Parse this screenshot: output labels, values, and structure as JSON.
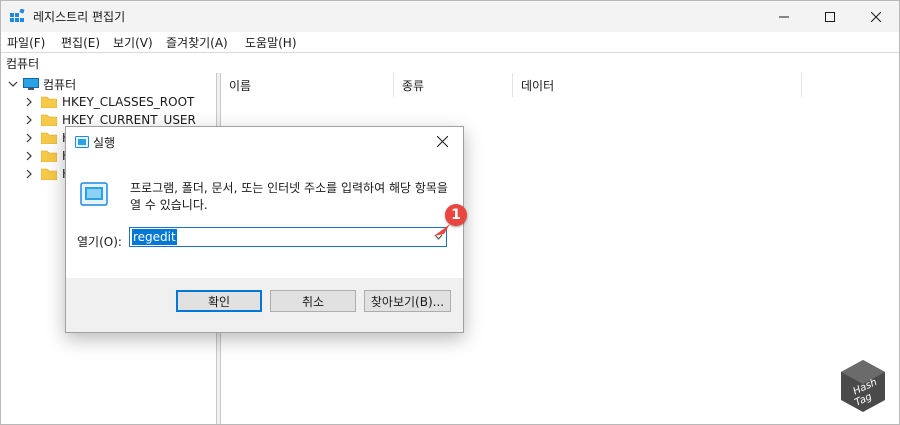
{
  "window": {
    "title": "레지스트리 편집기",
    "minimize_icon": "minimize-icon",
    "maximize_icon": "maximize-icon",
    "close_icon": "close-icon"
  },
  "menu": [
    "파일(F)",
    "편집(E)",
    "보기(V)",
    "즐겨찾기(A)",
    "도움말(H)"
  ],
  "address": "컴퓨터",
  "tree": {
    "root": "컴퓨터",
    "items": [
      "HKEY_CLASSES_ROOT",
      "HKEY_CURRENT_USER",
      "H",
      "H",
      "H"
    ]
  },
  "columns": [
    "이름",
    "종류",
    "데이터"
  ],
  "dialog": {
    "title": "실행",
    "description": "프로그램, 폴더, 문서, 또는 인터넷 주소를 입력하여 해당 항목을 열 수 있습니다.",
    "open_label": "열기(O):",
    "input_value": "regedit",
    "buttons": {
      "ok": "확인",
      "cancel": "취소",
      "browse": "찾아보기(B)..."
    }
  },
  "annotation": {
    "badge": "1"
  },
  "watermark": {
    "line1": "Hash",
    "line2": "Tag"
  },
  "colors": {
    "accent": "#0078d7",
    "badge": "#e8463e",
    "titlebar": "#f3f3f3",
    "folder": "#f7c948"
  }
}
